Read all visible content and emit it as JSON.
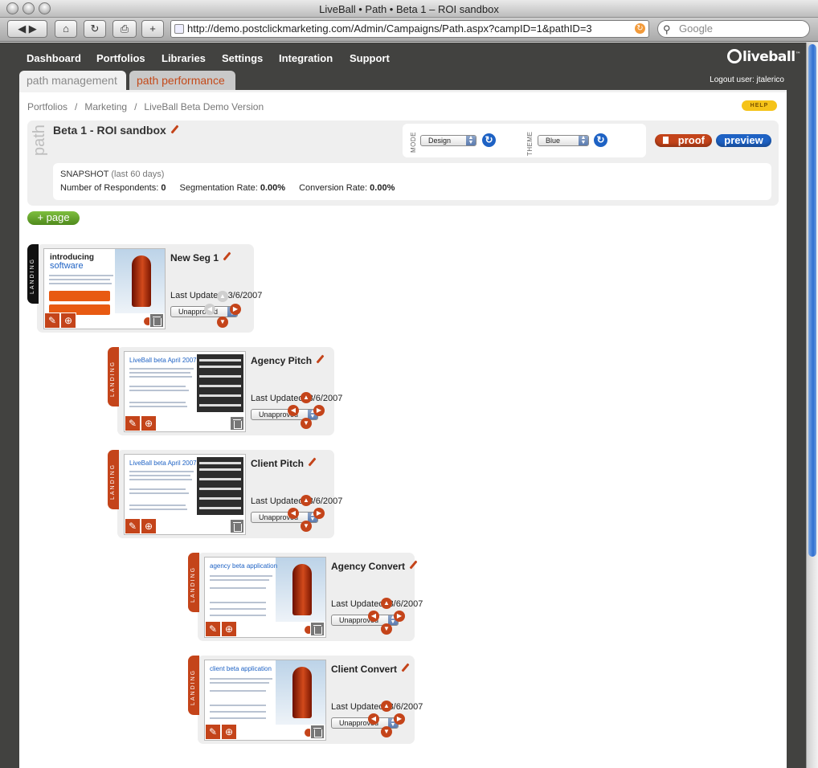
{
  "browser": {
    "window_title": "LiveBall • Path • Beta 1 – ROI sandbox",
    "url": "http://demo.postclickmarketing.com/Admin/Campaigns/Path.aspx?campID=1&pathID=3",
    "search_placeholder": "Google"
  },
  "nav": {
    "items": [
      "Dashboard",
      "Portfolios",
      "Libraries",
      "Settings",
      "Integration",
      "Support"
    ],
    "logo": "liveball",
    "logout": "Logout user: jtalerico"
  },
  "tabs": {
    "management": "path management",
    "performance": "path performance"
  },
  "breadcrumb": [
    "Portfolios",
    "Marketing",
    "LiveBall Beta Demo Version"
  ],
  "breadcrumb_sep": "/",
  "help": "HELP",
  "path": {
    "vertical_label": "path",
    "title": "Beta 1 - ROI sandbox",
    "mode_label": "MODE",
    "mode_value": "Design",
    "theme_label": "THEME",
    "theme_value": "Blue",
    "proof": "proof",
    "preview": "preview"
  },
  "snapshot": {
    "title": "SNAPSHOT",
    "subtitle": "(last 60 days)",
    "respondents_label": "Number of Respondents:",
    "respondents_value": "0",
    "segmentation_label": "Segmentation Rate:",
    "segmentation_value": "0.00%",
    "conversion_label": "Conversion Rate:",
    "conversion_value": "0.00%"
  },
  "add_page": "+ page",
  "pages": [
    {
      "name": "New Seg 1",
      "last_updated_label": "Last Updated:",
      "date": "3/6/2007",
      "status": "Unapproved",
      "type": "LANDING",
      "flag_color": "#111111"
    },
    {
      "name": "Agency Pitch",
      "last_updated_label": "Last Updated:",
      "date": "3/6/2007",
      "status": "Unapproved",
      "type": "LANDING",
      "flag_color": "#c4441a"
    },
    {
      "name": "Client Pitch",
      "last_updated_label": "Last Updated:",
      "date": "3/6/2007",
      "status": "Unapproved",
      "type": "LANDING",
      "flag_color": "#c4441a"
    },
    {
      "name": "Agency Convert",
      "last_updated_label": "Last Updated:",
      "date": "3/6/2007",
      "status": "Unapproved",
      "type": "LANDING",
      "flag_color": "#c4441a"
    },
    {
      "name": "Client Convert",
      "last_updated_label": "Last Updated:",
      "date": "3/6/2007",
      "status": "Unapproved",
      "type": "LANDING",
      "flag_color": "#c4441a"
    }
  ],
  "thumbs": {
    "intro_line1": "introducing",
    "intro_line2": "software",
    "pitch_header": "LiveBall beta April 2007",
    "agency_header": "agency beta application",
    "client_header": "client beta application",
    "brand": "live"
  },
  "colors": {
    "accent_orange": "#c4441a",
    "accent_blue": "#1e62c4",
    "add_green": "#5d9a26",
    "chrome_dark": "#424240"
  }
}
